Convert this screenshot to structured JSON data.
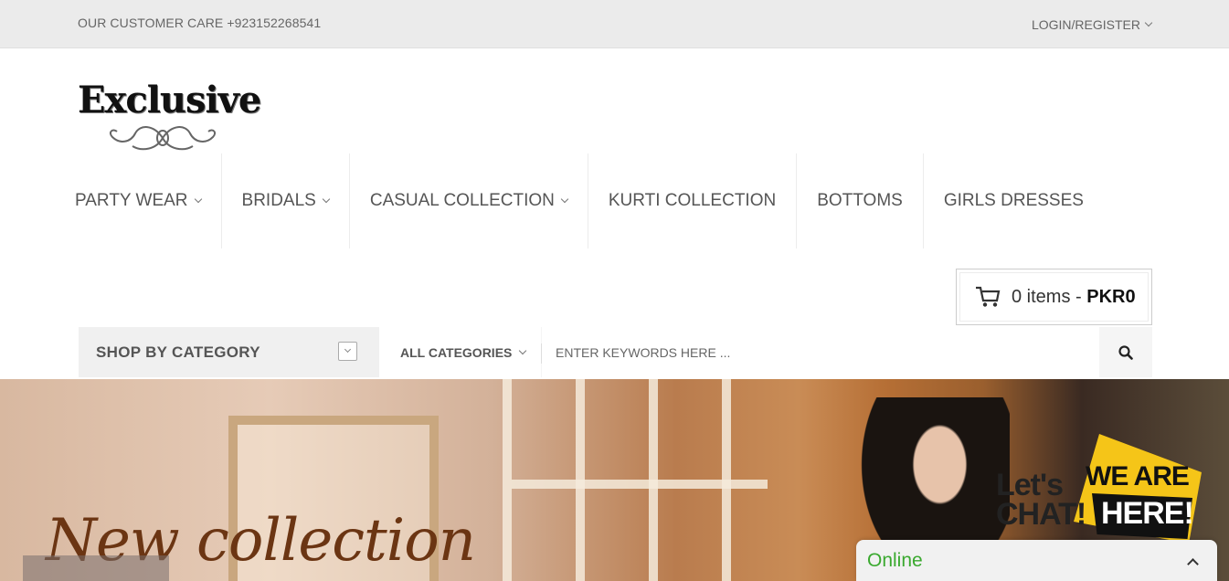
{
  "topbar": {
    "customer_care": "OUR CUSTOMER CARE +923152268541",
    "login": "LOGIN/REGISTER"
  },
  "logo": {
    "text": "Exclusive"
  },
  "nav": {
    "items": [
      {
        "label": "PARTY WEAR",
        "has_dropdown": true
      },
      {
        "label": "BRIDALS",
        "has_dropdown": true
      },
      {
        "label": "CASUAL COLLECTION",
        "has_dropdown": true
      },
      {
        "label": "KURTI COLLECTION",
        "has_dropdown": false
      },
      {
        "label": "BOTTOMS",
        "has_dropdown": false
      },
      {
        "label": "GIRLS DRESSES",
        "has_dropdown": false
      }
    ]
  },
  "cart": {
    "items": "0 items",
    "separator": " - ",
    "total": "PKR0",
    "icon": "cart-icon"
  },
  "category": {
    "label": "SHOP BY CATEGORY"
  },
  "search": {
    "category_select": "ALL CATEGORIES",
    "placeholder": "ENTER KEYWORDS HERE ...",
    "icon": "search-icon"
  },
  "banner": {
    "headline": "New collection"
  },
  "chat": {
    "lets": "Let's",
    "chat": "CHAT!",
    "we_are": "WE ARE",
    "here": "HERE!",
    "status": "Online",
    "status_color": "#3aa92f"
  }
}
